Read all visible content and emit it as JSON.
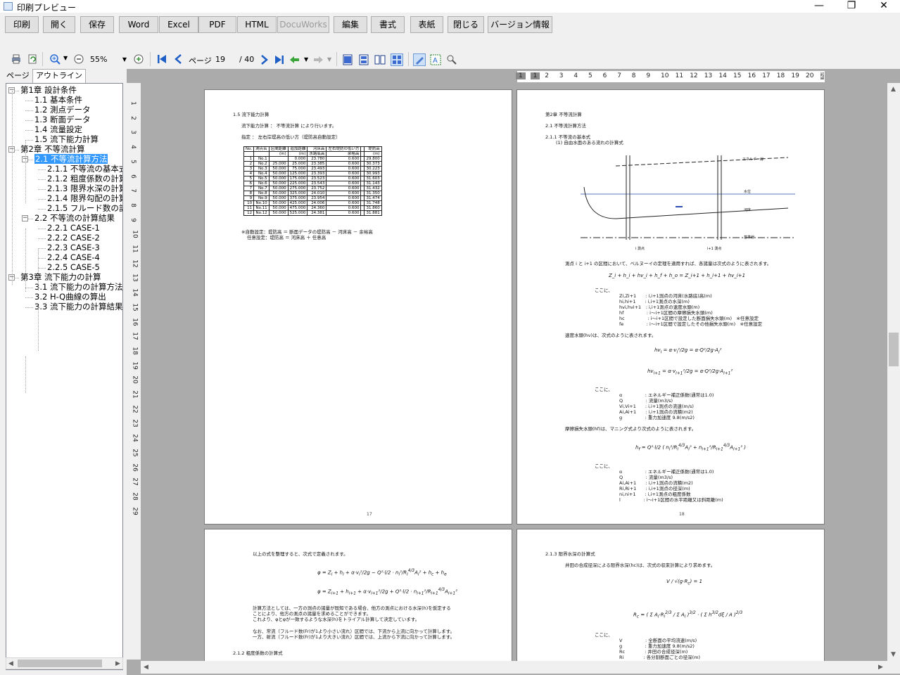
{
  "window": {
    "title": "印刷プレビュー",
    "min": "—",
    "max": "❐",
    "close": "✕"
  },
  "toolbar": {
    "buttons": [
      "印刷",
      "開く",
      "保存",
      "Word",
      "Excel",
      "PDF",
      "HTML",
      "DocuWorks",
      "編集",
      "書式",
      "表紙",
      "閉じる",
      "バージョン情報"
    ],
    "disabled": [
      "DocuWorks"
    ]
  },
  "nav": {
    "zoom": "55%",
    "page_label": "ページ",
    "page_value": "19",
    "page_total": "/ 40"
  },
  "tabs": [
    "ページ",
    "アウトライン"
  ],
  "outline": {
    "nodes": [
      {
        "text": "第1章 設計条件",
        "level": 0,
        "expander": "−"
      },
      {
        "text": "1.1 基本条件",
        "level": 1
      },
      {
        "text": "1.2 測点データ",
        "level": 1
      },
      {
        "text": "1.3 断面データ",
        "level": 1
      },
      {
        "text": "1.4 流量設定",
        "level": 1
      },
      {
        "text": "1.5 流下能力計算",
        "level": 1
      },
      {
        "text": "第2章 不等流計算",
        "level": 0,
        "expander": "−"
      },
      {
        "text": "2.1 不等流計算方法",
        "level": 1,
        "expander": "−",
        "selected": true
      },
      {
        "text": "2.1.1 不等流の基本式",
        "level": 2
      },
      {
        "text": "2.1.2 粗度係数の計算",
        "level": 2
      },
      {
        "text": "2.1.3 限界水深の計算",
        "level": 2
      },
      {
        "text": "2.1.4 限界勾配の計算",
        "level": 2
      },
      {
        "text": "2.1.5 フルード数の計算",
        "level": 2
      },
      {
        "text": "2.2 不等流の計算結果",
        "level": 1,
        "expander": "−"
      },
      {
        "text": "2.2.1 CASE-1",
        "level": 2
      },
      {
        "text": "2.2.2 CASE-2",
        "level": 2
      },
      {
        "text": "2.2.3 CASE-3",
        "level": 2
      },
      {
        "text": "2.2.4 CASE-4",
        "level": 2
      },
      {
        "text": "2.2.5 CASE-5",
        "level": 2
      },
      {
        "text": "第3章 流下能力の計算",
        "level": 0,
        "expander": "−"
      },
      {
        "text": "3.1 流下能力の計算方法",
        "level": 1
      },
      {
        "text": "3.2 H-Q曲線の算出",
        "level": 1
      },
      {
        "text": "3.3 流下能力の計算結果",
        "level": 1
      }
    ]
  },
  "rulers": {
    "horizontal": [
      "1",
      "1",
      "2",
      "3",
      "4",
      "5",
      "6",
      "7",
      "8",
      "9",
      "10",
      "11",
      "12",
      "13",
      "14",
      "15",
      "16",
      "17",
      "18",
      "19",
      "20",
      "2"
    ],
    "vertical": [
      "1",
      "2",
      "3",
      "4",
      "5",
      "6",
      "7",
      "8",
      "9",
      "10",
      "11",
      "12",
      "13",
      "14",
      "15",
      "16",
      "17",
      "18",
      "19",
      "20",
      "21",
      "22",
      "23",
      "24",
      "25",
      "26",
      "27",
      "28",
      "29"
    ]
  },
  "pages": {
    "p17": {
      "heading": "1.5 流下能力計算",
      "line1": "流下能力計算 ： 不等流計算 により行います。",
      "line2": "指定 ： 左右岸堤高の低い方（堤防高自動設定）",
      "table_header": [
        "No.",
        "測点名",
        "区間距離",
        "追加距離",
        "河床高",
        "左右堤防の低い方",
        "",
        "堤防高"
      ],
      "table_header2": [
        "",
        "",
        "(m)",
        "(m)",
        "水路底高",
        "余裕高",
        "",
        "(m)"
      ],
      "rows": [
        [
          "1",
          "No.1",
          "",
          "0.000",
          "23.780",
          "0.600",
          "",
          "29.800"
        ],
        [
          "2",
          "No.2",
          "25.000",
          "25.000",
          "23.385",
          "0.600",
          "",
          "30.373"
        ],
        [
          "3",
          "No.3",
          "50.000",
          "75.000",
          "23.493",
          "0.600",
          "",
          "30.223"
        ],
        [
          "4",
          "No.4",
          "50.000",
          "125.000",
          "23.393",
          "0.600",
          "",
          "30.993"
        ],
        [
          "5",
          "No.5",
          "50.000",
          "175.000",
          "23.523",
          "0.600",
          "",
          "31.603"
        ],
        [
          "6",
          "No.6",
          "50.000",
          "225.000",
          "23.543",
          "0.600",
          "",
          "31.143"
        ],
        [
          "7",
          "No.7",
          "50.000",
          "275.000",
          "23.752",
          "0.600",
          "",
          "31.432"
        ],
        [
          "8",
          "No.8",
          "50.000",
          "325.000",
          "24.010",
          "0.600",
          "",
          "31.350"
        ],
        [
          "9",
          "No.9",
          "50.000",
          "375.000",
          "23.954",
          "0.600",
          "",
          "31.474"
        ],
        [
          "10",
          "No.10",
          "50.000",
          "425.000",
          "24.006",
          "0.600",
          "",
          "31.748"
        ],
        [
          "11",
          "No.11",
          "50.000",
          "475.000",
          "24.360",
          "0.600",
          "",
          "31.860"
        ],
        [
          "12",
          "No.12",
          "50.000",
          "525.000",
          "24.381",
          "0.600",
          "",
          "31.881"
        ]
      ],
      "note1": "※自動設定：堤防高 ＝ 断面データの堤防高 － 河床高 － 余裕高",
      "note2": "任意設定：堤防高 ＝ 河床高 ＋ 任意高",
      "page_number": "17"
    },
    "p18": {
      "heading": "第2章 不等流計算",
      "sub1": "2.1 不等流計算方法",
      "sub2": "2.1.1 不等流の基本式",
      "sub3": "(1) 自由水面のある流れの計算式",
      "diagram_labels": [
        "エネルギー線",
        "水位",
        "河床",
        "基準線",
        "i 測点",
        "i+1 測点"
      ],
      "para1": "測点 i と i+1 の区間において、ベルヌーイの定理を適用すれば、各諸量は次式のように表されます。",
      "eq1": "Z_i + h_i + hv_i + h_f + h_o = Z_i+1 + h_i+1 + hv_i+1",
      "koko": "ここに、",
      "defs1": [
        "Zi,Zi+1　　: i,i+1測点の河床(水路底)高(m)",
        "hi,hi+1　　: i,i+1測点の水深(m)",
        "hvi,hvi+1　: i,i+1測点の速度水頭(m)",
        "hf　　　　　: i〜i+1区間の摩擦損失水頭(m)",
        "hc　　　　　: i〜i+1区間で設定した断面損失水頭(m)　※任意設定",
        "fe　　　　　: i〜i+1区間で設定したその他損失水頭(m)　※任意設定"
      ],
      "para2": "速度水頭(hv)は、次式のように表されます。",
      "defs2": [
        "α　　　　　: エネルギー補正係数(通常は1.0)",
        "Q　　　　　: 流量(m3/s)",
        "Vi,Vi+1　　: i,i+1測点の流速(m/s)",
        "Ai,Ai+1　　: i,i+1測点の流積(m2)",
        "g　　　　　: 重力加速度 9.8(m/s2)"
      ],
      "para3": "摩擦損失水頭(hf)は、マニング式より次式のように表されます。",
      "defs3": [
        "α　　　　　: エネルギー補正係数(通常は1.0)",
        "Q　　　　　: 流量(m3/s)",
        "Ai,Ai+1　　: i,i+1測点の流積(m2)",
        "Ri,Ri+1　　: i,i+1測点の径深(m)",
        "ni,ni+1　　: i,i+1測点の粗度係数",
        "l　　　　　: i〜i+1区間の水平距離又は斜距離(m)"
      ],
      "page_number": "18"
    },
    "p19": {
      "para1": "以上の式を整理すると、次式で定義されます。",
      "para2": "計算方法としては、一方の測点の諸量が既知である場合、他方の測点における水深(h)を仮定する",
      "para3": "ことにより、他方の測点の諸量を求めることができます。",
      "para4": "これより、φとφが一致するような水深(h)をトライアル計算して決定しています。",
      "para5": "なお、常流（フルード数(Fr)が1より小さい流れ）区間では、下流から上流に向かって計算します。",
      "para6": "一方、射流（フルード数(Fr)が1より大きい流れ）区間では、上流から下流に向かって計算します。",
      "sub": "2.1.2 粗度係数の計算式"
    },
    "p20": {
      "sub": "2.1.3 限界水深の計算式",
      "para1": "井田の合成径深による限界水深(hc)は、次式の収束計算により求めます。",
      "koko": "ここに、",
      "defs": [
        "V　　　　　: 全断面の平均流速(m/s)",
        "g　　　　　: 重力加速度 9.8(m/s2)",
        "Rc　　　　 : 井田の合成径深(m)",
        "Ri　　　　 : 各分割断面ごとの径深(m)"
      ]
    }
  },
  "colors": {
    "accent": "#3399ff",
    "viewer_bg": "#ababab"
  }
}
